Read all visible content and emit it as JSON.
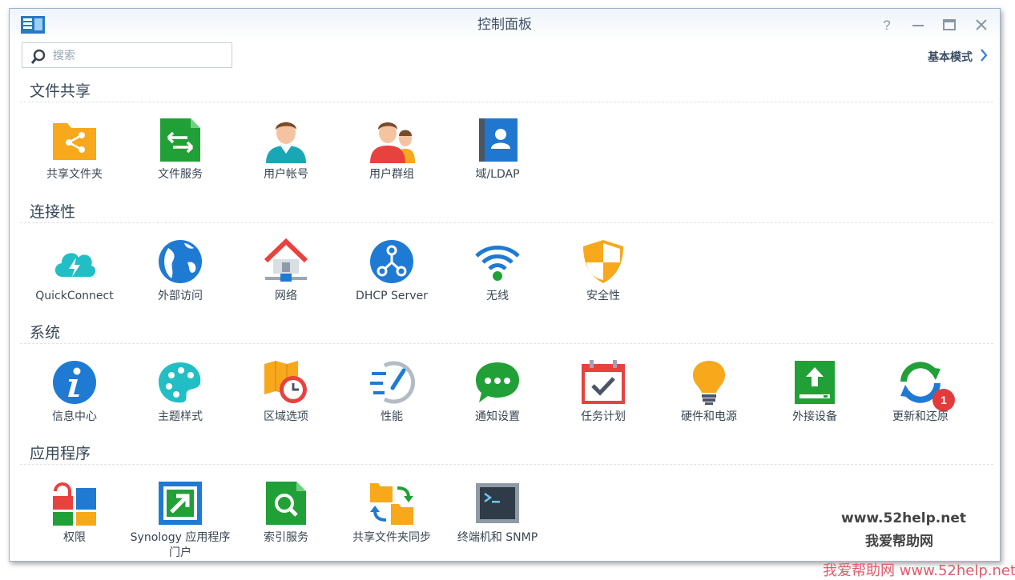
{
  "window": {
    "title": "控制面板",
    "buttons": {
      "help": "?",
      "minimize": "minimize",
      "maximize": "maximize",
      "close": "close"
    }
  },
  "search": {
    "placeholder": "搜索",
    "value": ""
  },
  "mode_link": {
    "label": "基本模式"
  },
  "sections": [
    {
      "title": "文件共享",
      "items": [
        {
          "label": "共享文件夹",
          "icon": "shared-folder-icon"
        },
        {
          "label": "文件服务",
          "icon": "file-services-icon"
        },
        {
          "label": "用户帐号",
          "icon": "user-icon"
        },
        {
          "label": "用户群组",
          "icon": "group-icon"
        },
        {
          "label": "域/LDAP",
          "icon": "ldap-icon"
        }
      ]
    },
    {
      "title": "连接性",
      "items": [
        {
          "label": "QuickConnect",
          "icon": "quickconnect-icon"
        },
        {
          "label": "外部访问",
          "icon": "globe-icon"
        },
        {
          "label": "网络",
          "icon": "network-icon"
        },
        {
          "label": "DHCP Server",
          "icon": "dhcp-icon"
        },
        {
          "label": "无线",
          "icon": "wifi-icon"
        },
        {
          "label": "安全性",
          "icon": "shield-icon"
        }
      ]
    },
    {
      "title": "系统",
      "items": [
        {
          "label": "信息中心",
          "icon": "info-icon"
        },
        {
          "label": "主题样式",
          "icon": "palette-icon"
        },
        {
          "label": "区域选项",
          "icon": "region-icon"
        },
        {
          "label": "性能",
          "icon": "performance-icon"
        },
        {
          "label": "通知设置",
          "icon": "notification-icon"
        },
        {
          "label": "任务计划",
          "icon": "calendar-icon"
        },
        {
          "label": "硬件和电源",
          "icon": "lightbulb-icon"
        },
        {
          "label": "外接设备",
          "icon": "external-device-icon"
        },
        {
          "label": "更新和还原",
          "icon": "update-icon",
          "badge": "1"
        }
      ]
    },
    {
      "title": "应用程序",
      "items": [
        {
          "label": "权限",
          "icon": "privileges-icon"
        },
        {
          "label": "Synology 应用程序门户",
          "icon": "portal-icon"
        },
        {
          "label": "索引服务",
          "icon": "indexing-icon"
        },
        {
          "label": "共享文件夹同步",
          "icon": "folder-sync-icon"
        },
        {
          "label": "终端机和 SNMP",
          "icon": "terminal-icon"
        }
      ]
    }
  ],
  "watermark": {
    "line1": "www.52help.net",
    "line2": "我爱帮助网",
    "line3": "我爱帮助网 www.52help.net"
  },
  "colors": {
    "accent": "#3a7bd5",
    "title_text": "#3f5166",
    "badge": "#e33b3b"
  }
}
